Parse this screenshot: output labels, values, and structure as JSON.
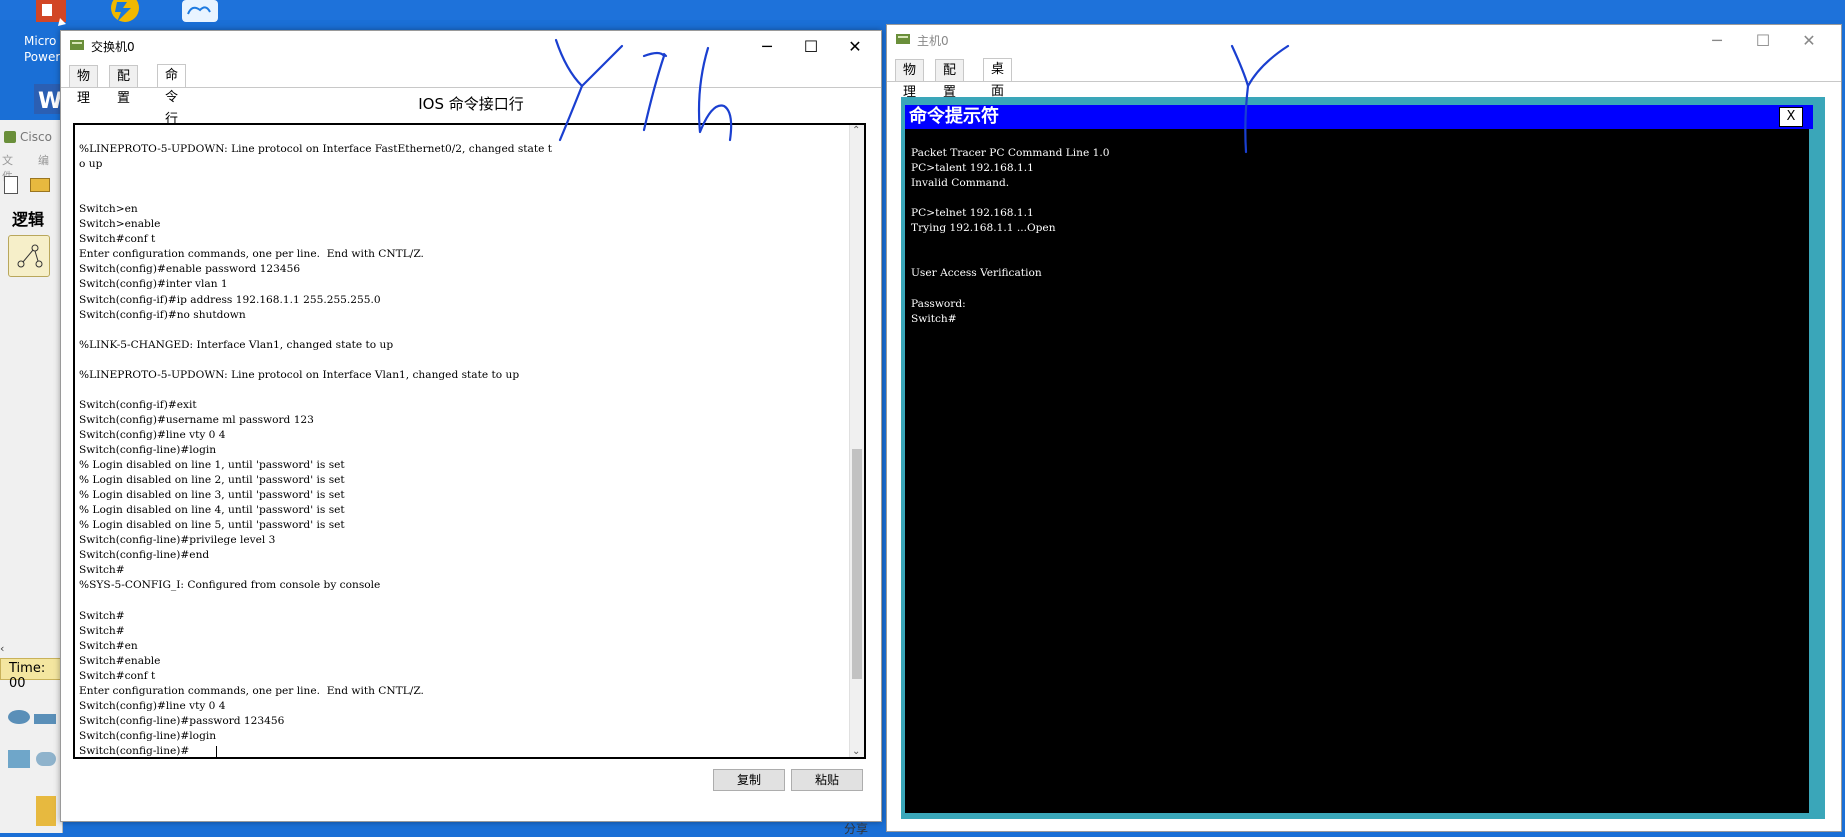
{
  "desktop": {
    "icons": [
      {
        "name": "powerpoint-desktop-icon",
        "label": "Micro\nPower"
      },
      {
        "name": "shortcut-desktop-icon",
        "label": ""
      },
      {
        "name": "cloud-desktop-icon",
        "label": ""
      }
    ],
    "label_micro": "Micro",
    "label_power": "Power"
  },
  "cisco_main": {
    "title": "Cisco",
    "menu_file": "文件",
    "menu_edit": "编",
    "logical_label": "逻辑",
    "time_label": "Time: 00",
    "share_text": "分享"
  },
  "switch_window": {
    "title": "交换机0",
    "tabs": [
      {
        "label": "物理",
        "active": false
      },
      {
        "label": "配置",
        "active": false
      },
      {
        "label": "命令行",
        "active": true
      }
    ],
    "heading": "IOS 命令接口行",
    "terminal_lines": [
      "%LINEPROTO-5-UPDOWN: Line protocol on Interface FastEthernet0/2, changed state t",
      "o up",
      "",
      "",
      "Switch>en",
      "Switch>enable",
      "Switch#conf t",
      "Enter configuration commands, one per line.  End with CNTL/Z.",
      "Switch(config)#enable password 123456",
      "Switch(config)#inter vlan 1",
      "Switch(config-if)#ip address 192.168.1.1 255.255.255.0",
      "Switch(config-if)#no shutdown",
      "",
      "%LINK-5-CHANGED: Interface Vlan1, changed state to up",
      "",
      "%LINEPROTO-5-UPDOWN: Line protocol on Interface Vlan1, changed state to up",
      "",
      "Switch(config-if)#exit",
      "Switch(config)#username ml password 123",
      "Switch(config)#line vty 0 4",
      "Switch(config-line)#login",
      "% Login disabled on line 1, until 'password' is set",
      "% Login disabled on line 2, until 'password' is set",
      "% Login disabled on line 3, until 'password' is set",
      "% Login disabled on line 4, until 'password' is set",
      "% Login disabled on line 5, until 'password' is set",
      "Switch(config-line)#privilege level 3",
      "Switch(config-line)#end",
      "Switch#",
      "%SYS-5-CONFIG_I: Configured from console by console",
      "",
      "Switch#",
      "Switch#",
      "Switch#en",
      "Switch#enable",
      "Switch#conf t",
      "Enter configuration commands, one per line.  End with CNTL/Z.",
      "Switch(config)#line vty 0 4",
      "Switch(config-line)#password 123456",
      "Switch(config-line)#login",
      "Switch(config-line)#"
    ],
    "copy_button": "复制",
    "paste_button": "粘贴",
    "scroll_position": 0.83
  },
  "pc_window": {
    "title": "主机0",
    "tabs": [
      {
        "label": "物理",
        "active": false
      },
      {
        "label": "配置",
        "active": false
      },
      {
        "label": "桌面",
        "active": true
      }
    ],
    "cmd_title": "命令提示符",
    "cmd_close": "X",
    "cmd_lines": [
      "Packet Tracer PC Command Line 1.0",
      "PC>talent 192.168.1.1",
      "Invalid Command.",
      "",
      "PC>telnet 192.168.1.1",
      "Trying 192.168.1.1 ...Open",
      "",
      "",
      "User Access Verification",
      "",
      "Password:",
      "Switch#"
    ]
  },
  "colors": {
    "desktop_blue": "#1a6fd6",
    "cmd_title_blue": "#0000ff",
    "pc_desktop_teal": "#3aa6b9",
    "ink_blue": "#1a3fd0"
  }
}
